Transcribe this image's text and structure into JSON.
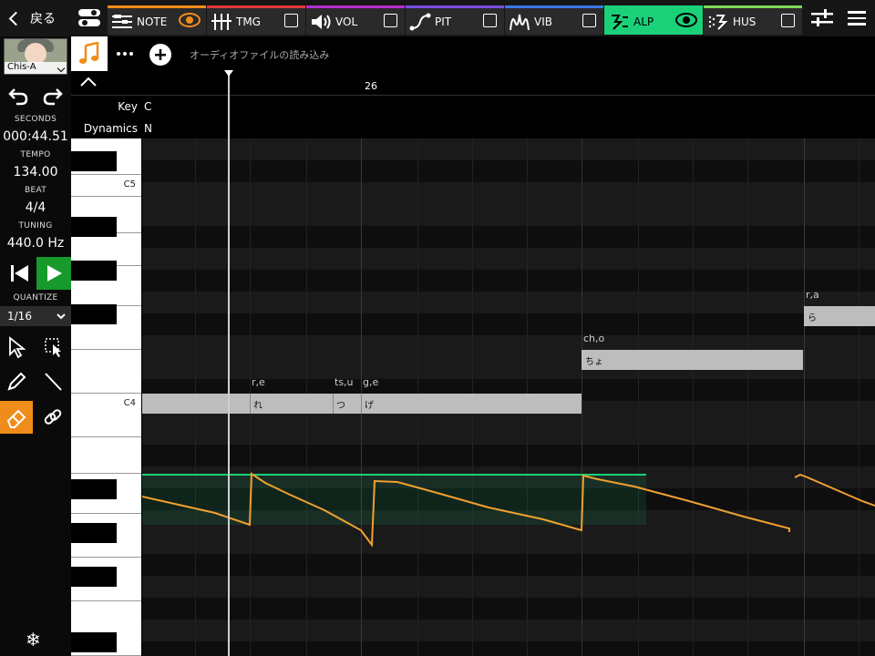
{
  "topbar": {
    "back_label": "戻る",
    "tabs": [
      {
        "id": "note",
        "label": "NOTE",
        "color": "#f08c1a",
        "icon": "note-lines-icon",
        "indicator": "eye"
      },
      {
        "id": "tmg",
        "label": "TMG",
        "color": "#e23a3a",
        "icon": "timing-icon",
        "indicator": "checkbox"
      },
      {
        "id": "vol",
        "label": "VOL",
        "color": "#b42fcf",
        "icon": "speaker-icon",
        "indicator": "checkbox"
      },
      {
        "id": "pit",
        "label": "PIT",
        "color": "#7a4fe0",
        "icon": "pitch-curve-icon",
        "indicator": "checkbox"
      },
      {
        "id": "vib",
        "label": "VIB",
        "color": "#3a79e6",
        "icon": "vibrato-icon",
        "indicator": "checkbox"
      },
      {
        "id": "alp",
        "label": "ALP",
        "color": "#1ad17a",
        "icon": "alpha-wave-icon",
        "indicator": "eye",
        "active": true
      },
      {
        "id": "hus",
        "label": "HUS",
        "color": "#7ed956",
        "icon": "husky-icon",
        "indicator": "checkbox"
      }
    ]
  },
  "singer": {
    "name": "Chis-A"
  },
  "transport": {
    "seconds_label": "SECONDS",
    "seconds": "000:44.51",
    "tempo_label": "TEMPO",
    "tempo": "134.00",
    "beat_label": "BEAT",
    "beat": "4/4",
    "tuning_label": "TUNING",
    "tuning": "440.0 Hz"
  },
  "quantize": {
    "label": "QUANTIZE",
    "value": "1/16"
  },
  "editor": {
    "audio_load": "オーディオファイルの読み込み",
    "measure": "26",
    "key_label": "Key",
    "key_value": "C",
    "dynamics_label": "Dynamics",
    "dynamics_value": "N",
    "key_c5": "C5",
    "key_c4": "C4"
  },
  "notes": [
    {
      "lyric": "れ",
      "phoneme": "r,e"
    },
    {
      "lyric": "つ",
      "phoneme": "ts,u"
    },
    {
      "lyric": "げ",
      "phoneme": "g,e"
    },
    {
      "lyric": "ちょ",
      "phoneme": "ch,o"
    },
    {
      "lyric": "ら",
      "phoneme": "r,a"
    }
  ],
  "colors": {
    "alp_accent": "#1ad17a",
    "curve": "#f0a030",
    "play_button": "#17992c",
    "tool_selected": "#f08c1a"
  }
}
